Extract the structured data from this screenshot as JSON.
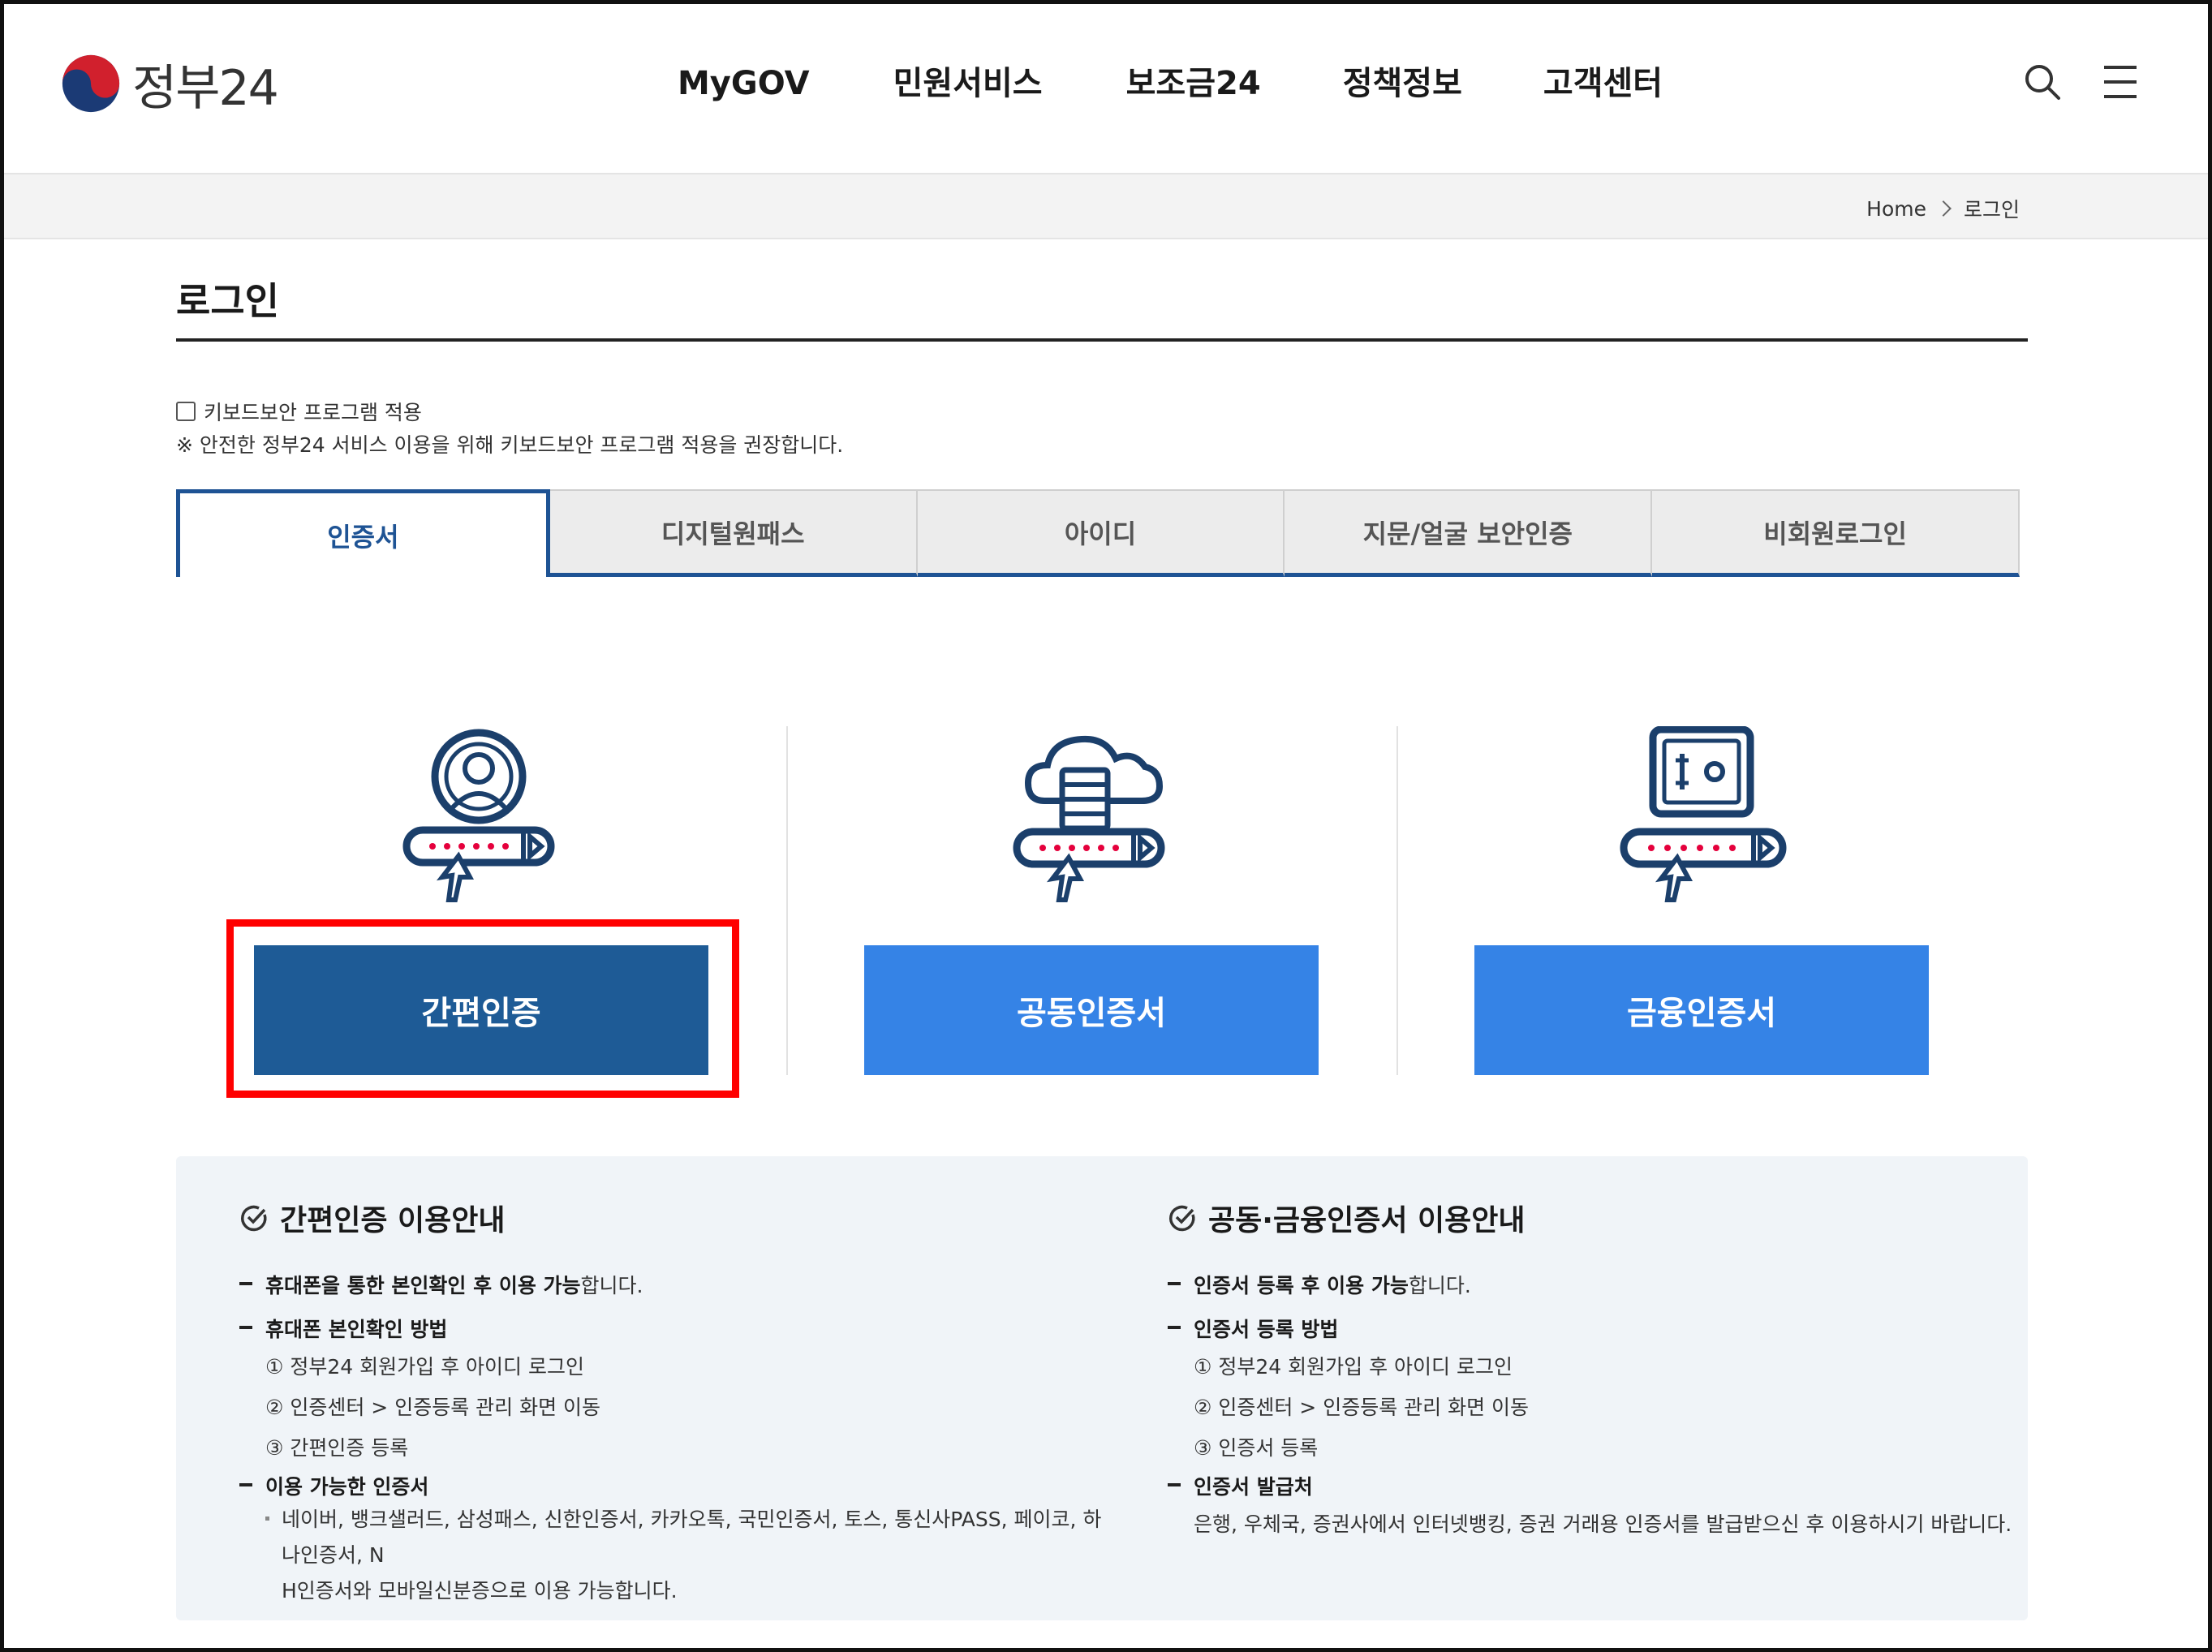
{
  "header": {
    "logo_text": "정부24",
    "nav": [
      "MyGOV",
      "민원서비스",
      "보조금24",
      "정책정보",
      "고객센터"
    ]
  },
  "breadcrumb": {
    "home": "Home",
    "current": "로그인"
  },
  "page_title": "로그인",
  "keyboard": {
    "label": "키보드보안 프로그램 적용",
    "note": "※ 안전한 정부24 서비스 이용을 위해 키보드보안 프로그램 적용을 권장합니다."
  },
  "tabs": [
    "인증서",
    "디지털원패스",
    "아이디",
    "지문/얼굴 보안인증",
    "비회원로그인"
  ],
  "active_tab": "인증서",
  "options": [
    "간편인증",
    "공동인증서",
    "금융인증서"
  ],
  "colors": {
    "primary": "#1e5b96",
    "accent": "#3583e6",
    "highlight": "#ff0000",
    "icon_navy": "#1b3f6b",
    "icon_dots": "#e5003c"
  },
  "info": {
    "simple": {
      "title": "간편인증 이용안내",
      "l1_bold": "휴대폰을 통한 본인확인 후 이용 가능",
      "l1_rest": "합니다.",
      "l2_bold": "휴대폰 본인확인 방법",
      "steps": [
        "① 정부24 회원가입 후 아이디 로그인",
        "② 인증센터 > 인증등록 관리 화면 이동",
        "③ 간편인증 등록"
      ],
      "l3_bold": "이용 가능한 인증서",
      "available": "네이버, 뱅크샐러드, 삼성패스, 신한인증서, 카카오톡, 국민인증서, 토스, 통신사PASS, 페이코, 하나인증서, N",
      "available2": "H인증서와 모바일신분증으로 이용 가능합니다."
    },
    "cert": {
      "title": "공동·금융인증서 이용안내",
      "l1_bold": "인증서 등록 후 이용 가능",
      "l1_rest": "합니다.",
      "l2_bold": "인증서 등록 방법",
      "steps": [
        "① 정부24 회원가입 후 아이디 로그인",
        "② 인증센터 > 인증등록 관리 화면 이동",
        "③ 인증서 등록"
      ],
      "l3_bold": "인증서 발급처",
      "issuer": "은행, 우체국, 증권사에서 인터넷뱅킹, 증권 거래용 인증서를 발급받으신 후 이용하시기 바랍니다."
    }
  }
}
